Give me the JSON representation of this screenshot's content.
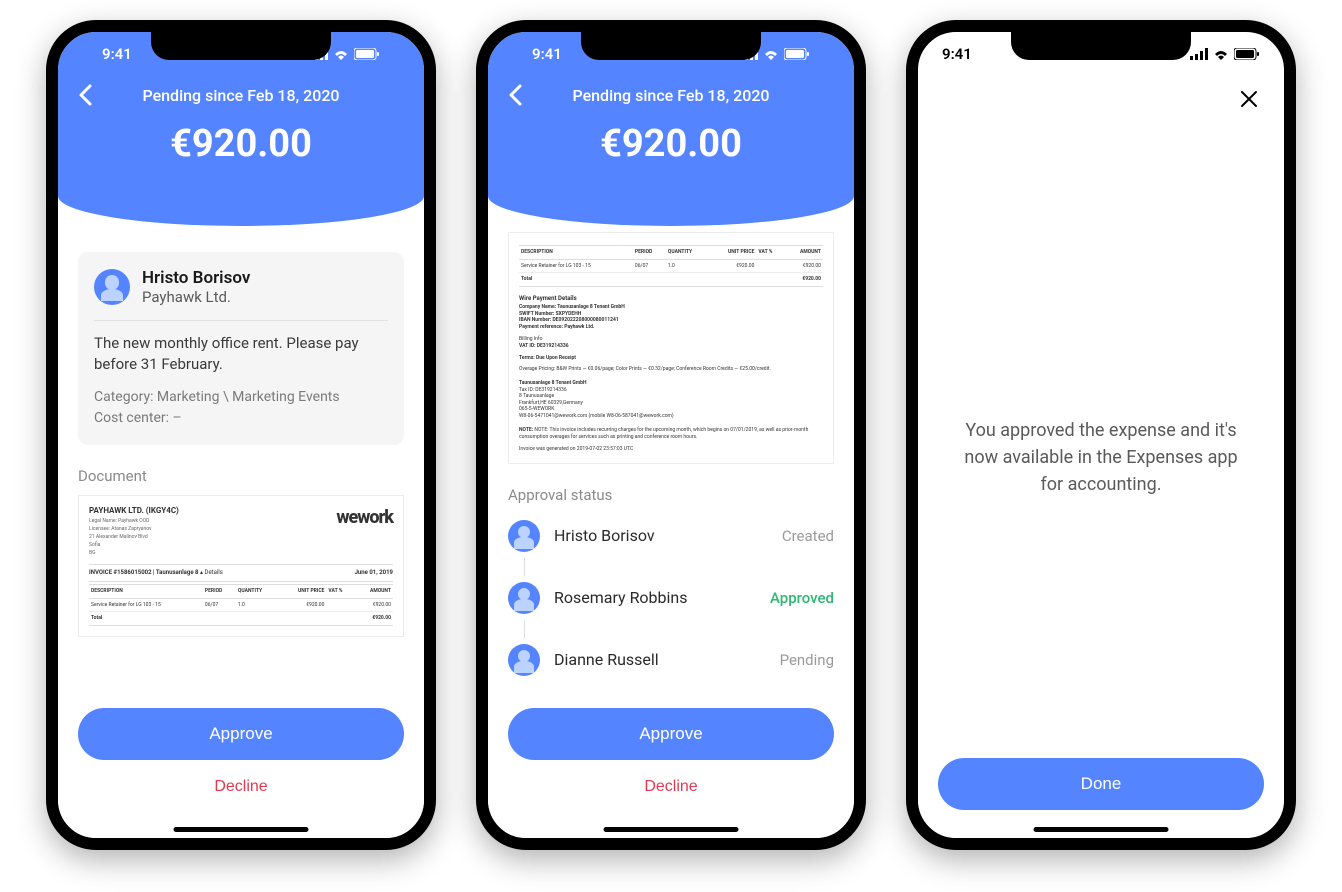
{
  "status_time": "9:41",
  "header": {
    "pending_label": "Pending since Feb 18, 2020",
    "amount": "€920.00"
  },
  "requester": {
    "name": "Hristo Borisov",
    "company": "Payhawk Ltd.",
    "note": "The new monthly office rent. Please pay before 31 February.",
    "category_label": "Category: Marketing \\ Marketing Events",
    "costcenter_label": "Cost center: –"
  },
  "document": {
    "section_label": "Document",
    "company_header": "PAYHAWK LTD. (IKGY4C)",
    "legal_name": "Legal Name: Payhawk OOD",
    "licensee": "Licensee: Atanas Zapryanov",
    "address": "21 Alexander Malinov Blvd",
    "city": "Sofia",
    "country": "BG",
    "brand": "wework",
    "invoice_line": "INVOICE #1586015002 | Taunusanlage 8",
    "details_label": "▴ Details",
    "invoice_date": "June 01, 2019",
    "columns": {
      "description": "DESCRIPTION",
      "period": "PERIOD",
      "quantity": "QUANTITY",
      "unit_price": "UNIT PRICE",
      "vat": "VAT %",
      "amount": "AMOUNT"
    },
    "row": {
      "desc": "Service Retainer for LG 103 - 15",
      "period": "06/07",
      "qty": "1.0",
      "unit_price": "€920.00",
      "vat": "",
      "amount": "€920.00"
    },
    "total_label": "Total",
    "total_amount": "€920.00",
    "wire_title": "Wire Payment Details",
    "wire_company": "Company Name: Taunusanlage 8 Tenant GmbH",
    "wire_swift": "SWIFT Number: SXPYDEHH",
    "wire_iban": "IBAN Number: DE092022208000080011241",
    "wire_ref": "Payment reference: Payhawk Ltd.",
    "billing_title": "Billing Info",
    "billing_vat": "VAT ID: DE319214336",
    "terms": "Terms: Due Upon Receipt",
    "overage": "Overage Pricing: B&W Prints — €0.06/page; Color Prints — €0.32/page; Conference Room Credits — €25.00/credit.",
    "tenant_name": "Taunusanlage 8 Tenant GmbH",
    "tenant_tax": "Tax ID: DE319214336",
    "tenant_addr1": "8 Taunusanlage",
    "tenant_addr2": "Frankfurt,HE 60329,Germany",
    "tenant_phone": "065-5-WEWORK",
    "tenant_email": "W8-06-5471041@wework.com (mobile W8-06-587041@wework.com)",
    "note": "NOTE: This invoice includes recurring charges for the upcoming month, which begins on 07/01/2019, as well as prior-month consumption overages for services such as printing and conference room hours.",
    "generated": "Invoice was generated on 2019-07-02 23:57:03 UTC"
  },
  "approval": {
    "section_label": "Approval status",
    "items": [
      {
        "name": "Hristo Borisov",
        "status_label": "Created",
        "status_class": "created"
      },
      {
        "name": "Rosemary Robbins",
        "status_label": "Approved",
        "status_class": "approved"
      },
      {
        "name": "Dianne Russell",
        "status_label": "Pending",
        "status_class": "pending"
      }
    ]
  },
  "actions": {
    "approve": "Approve",
    "decline": "Decline",
    "done": "Done"
  },
  "confirmation": {
    "message": "You approved the expense and it's now available in the Expenses app for accounting."
  }
}
